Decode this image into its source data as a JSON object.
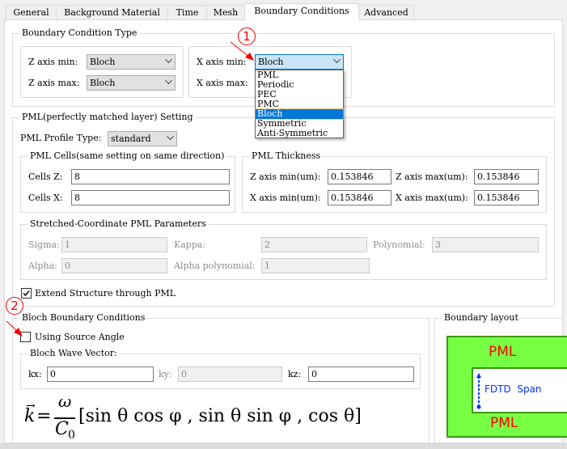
{
  "tabs": [
    "General",
    "Background Material",
    "Time",
    "Mesh",
    "Boundary Conditions",
    "Advanced"
  ],
  "active_tab": "Boundary Conditions",
  "bct": {
    "title": "Boundary Condition Type",
    "z_min_label": "Z axis min:",
    "z_min": "Bloch",
    "z_max_label": "Z axis max:",
    "z_max": "Bloch",
    "x_min_label": "X axis min:",
    "x_min": "Bloch",
    "x_max_label": "X axis max:",
    "options": [
      "PML",
      "Periodic",
      "PEC",
      "PMC",
      "Bloch",
      "Symmetric",
      "Anti-Symmetric"
    ],
    "selected_option": "Bloch"
  },
  "annotations": {
    "one": "1",
    "two": "2",
    "color": "#e00000"
  },
  "pml": {
    "title": "PML(perfectly matched layer) Setting",
    "profile_label": "PML Profile Type:",
    "profile": "standard",
    "cells_title": "PML Cells(same setting on same direction)",
    "cells_z_label": "Cells Z:",
    "cells_z": "8",
    "cells_x_label": "Cells X:",
    "cells_x": "8",
    "thick_title": "PML Thickness",
    "z_min_label": "Z axis min(um):",
    "z_min": "0.153846",
    "z_max_label": "Z axis max(um):",
    "z_max": "0.153846",
    "x_min_label": "X axis min(um):",
    "x_min": "0.153846",
    "x_max_label": "X axis max(um):",
    "x_max": "0.153846",
    "sc_title": "Stretched-Coordinate PML Parameters",
    "sigma_label": "Sigma:",
    "sigma": "1",
    "kappa_label": "Kappa:",
    "kappa": "2",
    "poly_label": "Polynomial:",
    "poly": "3",
    "alpha_label": "Alpha:",
    "alpha": "0",
    "alpha_poly_label": "Alpha polynomial:",
    "alpha_poly": "1",
    "extend_label": "Extend Structure through PML",
    "extend_checked": true
  },
  "bloch": {
    "title": "Bloch Boundary Conditions",
    "source_angle_label": "Using Source Angle",
    "source_angle_checked": false,
    "wv_title": "Bloch Wave Vector:",
    "kx_label": "kx:",
    "kx": "0",
    "ky_label": "ky:",
    "ky": "0",
    "kz_label": "kz:",
    "kz": "0",
    "formula_lhs": "k",
    "formula_num": "ω",
    "formula_den": "C",
    "formula_sub": "0",
    "formula_rhs": "[sin θ cos φ , sin θ sin φ , cos θ]"
  },
  "layout": {
    "title": "Boundary layout",
    "pml_top": "PML",
    "pml_bottom": "PML",
    "span": "FDTD  Span",
    "pml_color": "#77ff44",
    "pml_text_color": "#ff0000",
    "span_color": "#0033ff"
  }
}
